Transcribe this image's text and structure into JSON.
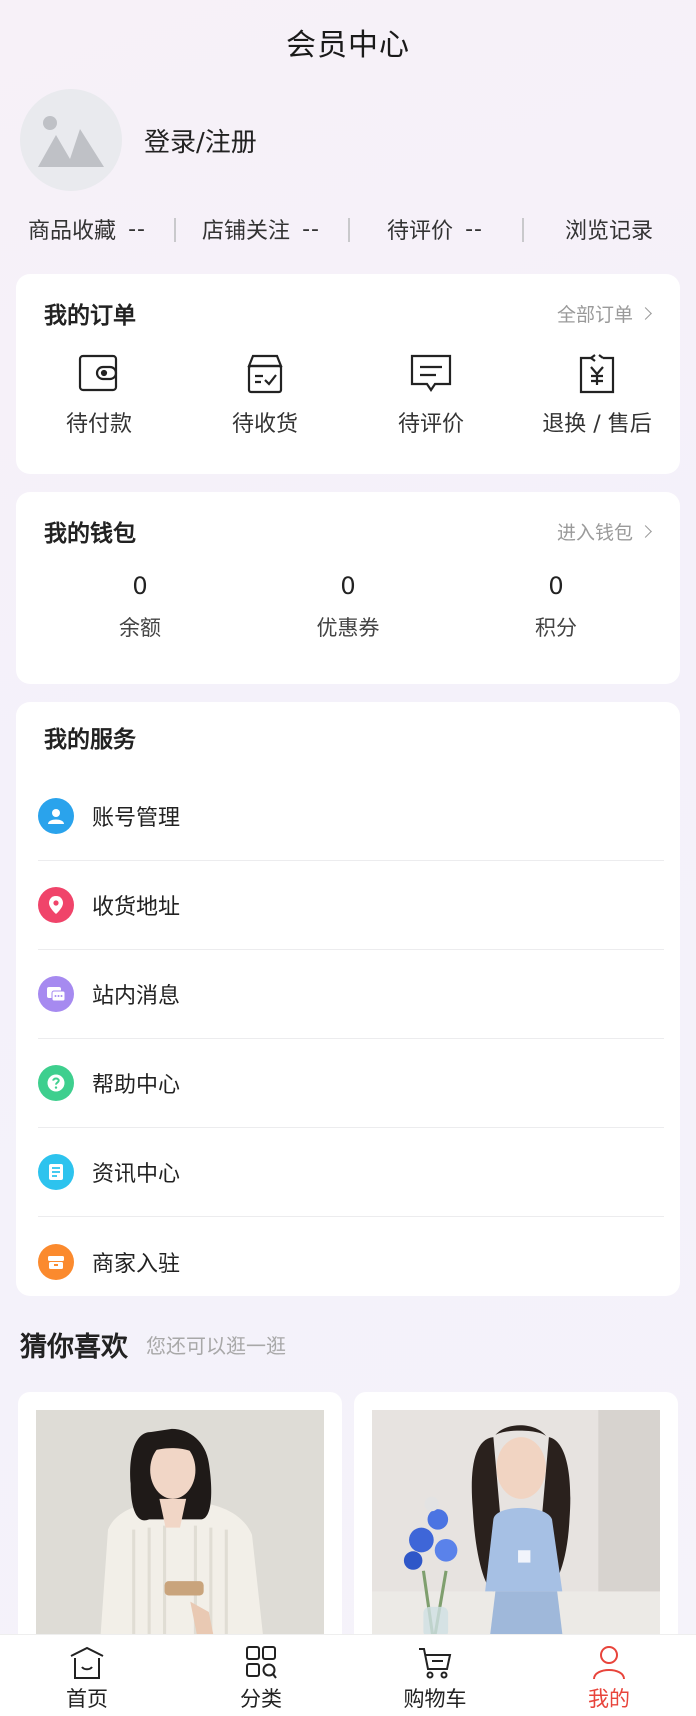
{
  "header": {
    "title": "会员中心"
  },
  "profile": {
    "login_label": "登录/注册"
  },
  "stats": [
    {
      "label": "商品收藏",
      "value": "--"
    },
    {
      "label": "店铺关注",
      "value": "--"
    },
    {
      "label": "待评价",
      "value": "--"
    },
    {
      "label": "浏览记录"
    }
  ],
  "orders": {
    "title": "我的订单",
    "more": "全部订单",
    "items": [
      {
        "label": "待付款",
        "icon": "wallet-icon"
      },
      {
        "label": "待收货",
        "icon": "package-icon"
      },
      {
        "label": "待评价",
        "icon": "comment-icon"
      },
      {
        "label": "退换 / 售后",
        "icon": "refund-icon"
      }
    ]
  },
  "wallet": {
    "title": "我的钱包",
    "more": "进入钱包",
    "items": [
      {
        "value": "0",
        "label": "余额"
      },
      {
        "value": "0",
        "label": "优惠券"
      },
      {
        "value": "0",
        "label": "积分"
      }
    ]
  },
  "services": {
    "title": "我的服务",
    "items": [
      {
        "label": "账号管理",
        "icon": "user-icon",
        "color": "#2aa3ec"
      },
      {
        "label": "收货地址",
        "icon": "location-icon",
        "color": "#f0446a"
      },
      {
        "label": "站内消息",
        "icon": "message-icon",
        "color": "#a68af0"
      },
      {
        "label": "帮助中心",
        "icon": "help-icon",
        "color": "#3ecf8e"
      },
      {
        "label": "资讯中心",
        "icon": "news-icon",
        "color": "#2dc3ee"
      },
      {
        "label": "商家入驻",
        "icon": "store-icon",
        "color": "#fb8a2e"
      }
    ]
  },
  "recommend": {
    "title": "猜你喜欢",
    "subtitle": "您还可以逛一逛"
  },
  "tabbar": {
    "items": [
      {
        "label": "首页",
        "icon": "home-icon"
      },
      {
        "label": "分类",
        "icon": "category-icon"
      },
      {
        "label": "购物车",
        "icon": "cart-icon"
      },
      {
        "label": "我的",
        "icon": "profile-icon",
        "active": true
      }
    ],
    "active_color": "#e8443b"
  }
}
